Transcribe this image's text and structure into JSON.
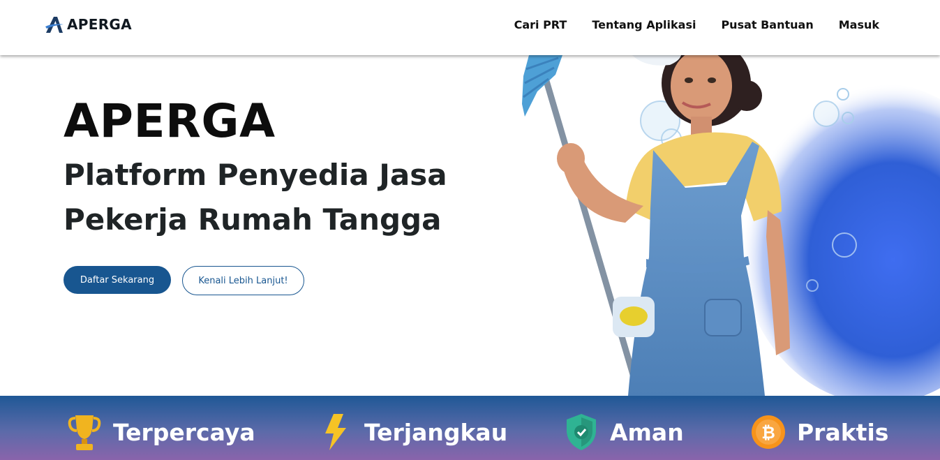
{
  "navbar": {
    "brand": "APERGA",
    "links": [
      "Cari PRT",
      "Tentang Aplikasi",
      "Pusat Bantuan",
      "Masuk"
    ]
  },
  "hero": {
    "title": "APERGA",
    "subtitle_line1": "Platform Penyedia Jasa",
    "subtitle_line2": "Pekerja Rumah Tangga",
    "primary_button": "Daftar Sekarang",
    "secondary_button": "Kenali Lebih Lanjut!",
    "illustration": "cleaning-lady-with-mop-illustration"
  },
  "features": [
    {
      "label": "Terpercaya",
      "icon": "trophy-icon"
    },
    {
      "label": "Terjangkau",
      "icon": "lightning-icon"
    },
    {
      "label": "Aman",
      "icon": "shield-check-icon"
    },
    {
      "label": "Praktis",
      "icon": "bitcoin-coin-icon"
    }
  ],
  "colors": {
    "primary": "#185690",
    "feature_gradient_top": "#1f5896",
    "feature_gradient_bottom": "#8a64ab",
    "hero_blob": "#2f5fd6"
  }
}
